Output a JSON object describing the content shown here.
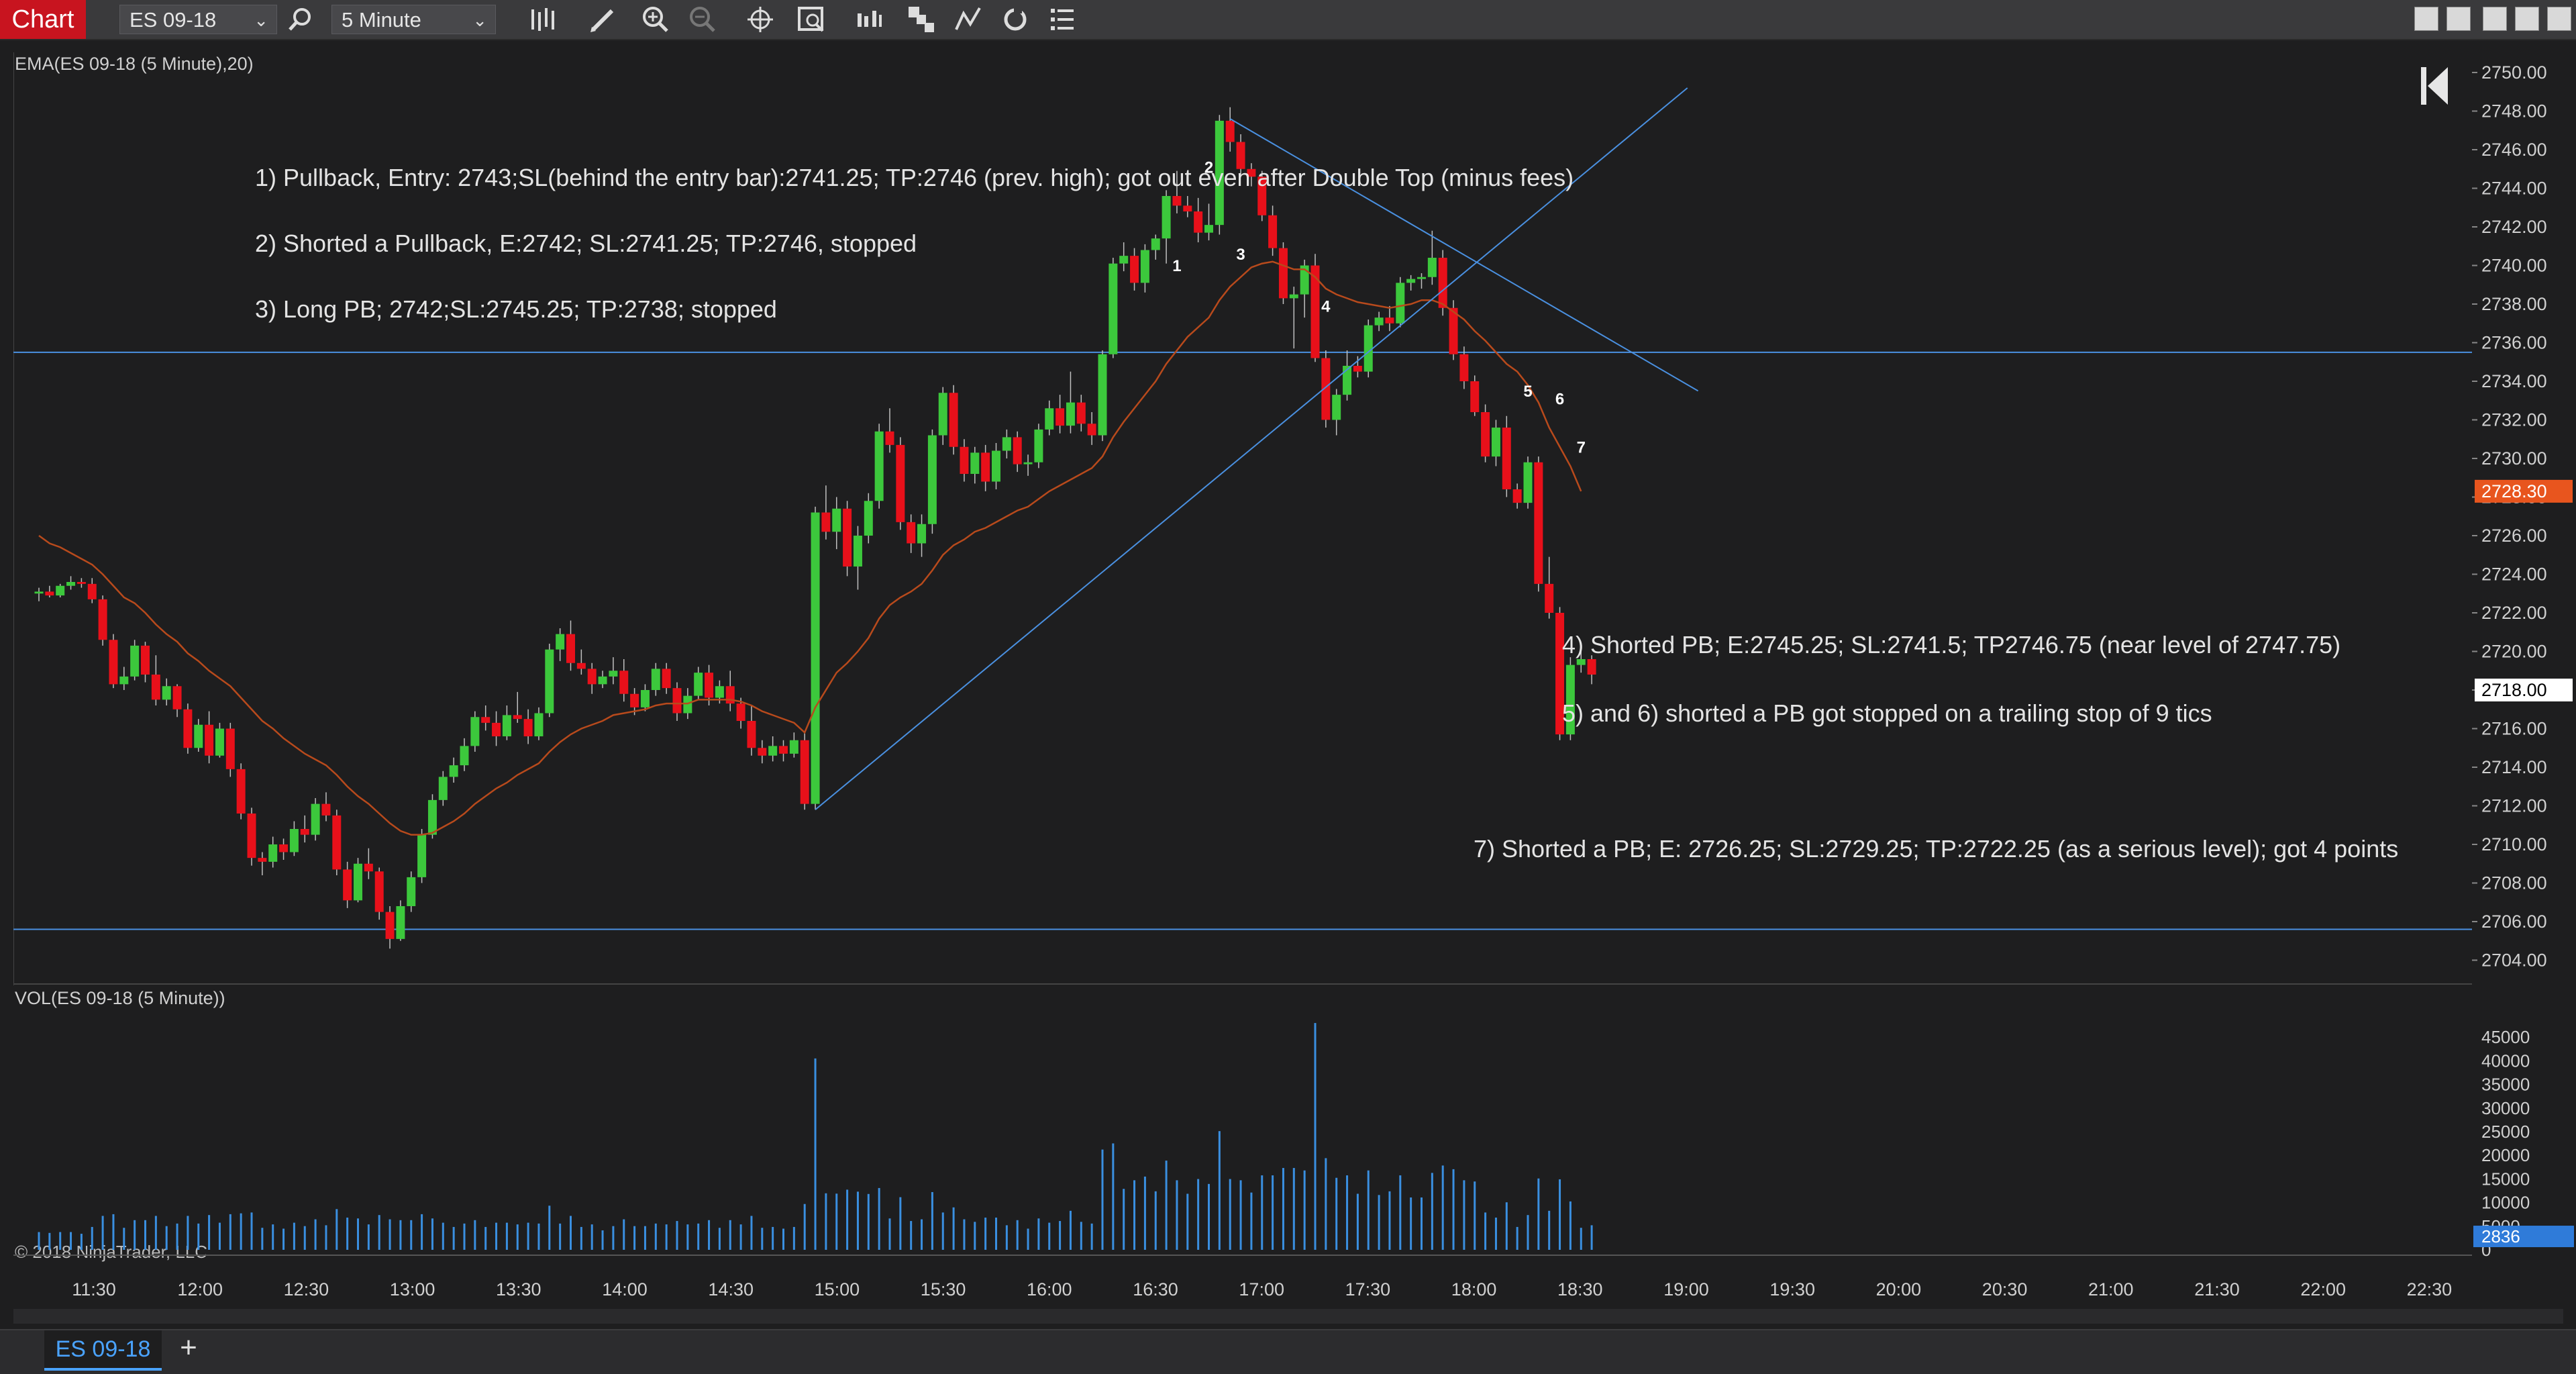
{
  "toolbar": {
    "chart_tab": "Chart",
    "instrument": "ES 09-18",
    "interval": "5 Minute",
    "icons": [
      "search-icon",
      "bars-type-icon",
      "pencil-icon",
      "zoom-in-icon",
      "zoom-out-icon",
      "crosshair-icon",
      "data-box-icon",
      "indicators-icon",
      "strategies-icon",
      "drawing-tools-icon",
      "reload-icon",
      "properties-icon"
    ],
    "window_buttons": [
      "tile-icon",
      "tile2-icon",
      "minimize-icon",
      "maximize-icon",
      "close-icon"
    ]
  },
  "panels": {
    "price_label": "EMA(ES 09-18 (5 Minute),20)",
    "volume_label": "VOL(ES 09-18 (5 Minute))"
  },
  "annotations": [
    "1)  Pullback, Entry: 2743;SL(behind the entry bar):2741.25; TP:2746 (prev. high); got out even after Double Top (minus fees)",
    "2) Shorted a Pullback, E:2742; SL:2741.25; TP:2746, stopped",
    "3) Long PB; 2742;SL:2745.25; TP:2738; stopped",
    "4) Shorted PB; E:2745.25; SL:2741.5; TP2746.75 (near level of 2747.75)",
    "5) and 6) shorted a PB got stopped on a trailing stop of 9 tics",
    "7) Shorted a PB; E: 2726.25; SL:2729.25; TP:2722.25 (as a serious level); got 4 points"
  ],
  "copyright": "© 2018 NinjaTrader, LLC",
  "bottom_tab": "ES 09-18",
  "add_tab": "+",
  "chart_data": {
    "type": "candlestick",
    "price_ylim": [
      2703,
      2751
    ],
    "price_ticks": [
      "2750.00",
      "2748.00",
      "2746.00",
      "2744.00",
      "2742.00",
      "2740.00",
      "2738.00",
      "2736.00",
      "2734.00",
      "2732.00",
      "2730.00",
      "2728.00",
      "2726.00",
      "2724.00",
      "2722.00",
      "2720.00",
      "2718.00",
      "2716.00",
      "2714.00",
      "2712.00",
      "2710.00",
      "2708.00",
      "2706.00",
      "2704.00"
    ],
    "current_price": "2718.00",
    "ema_label_value": "2728.30",
    "volume_ticks": [
      "45000",
      "40000",
      "35000",
      "30000",
      "25000",
      "20000",
      "15000",
      "10000",
      "5000",
      "0"
    ],
    "volume_ylim": [
      0,
      50000
    ],
    "current_volume": "2836",
    "x_ticks": [
      "11:30",
      "12:00",
      "12:30",
      "13:00",
      "13:30",
      "14:00",
      "14:30",
      "15:00",
      "15:30",
      "16:00",
      "16:30",
      "17:00",
      "17:30",
      "18:00",
      "18:30",
      "19:00",
      "19:30",
      "20:00",
      "20:30",
      "21:00",
      "21:30",
      "22:00",
      "22:30"
    ],
    "horizontal_levels": [
      2735.5,
      2705.6
    ],
    "colors": {
      "up": "#3cc83c",
      "down": "#e8101a",
      "ema": "#b84a1c",
      "volume": "#3a8fe0",
      "lines": "#4a90e0",
      "background": "#1e1e1f",
      "ema_label": "#e8551e"
    },
    "candles": [
      [
        2723,
        2723.3,
        2722.6,
        2723.1
      ],
      [
        2723.1,
        2723.4,
        2722.8,
        2722.9
      ],
      [
        2722.9,
        2723.5,
        2722.8,
        2723.4
      ],
      [
        2723.4,
        2723.9,
        2723.2,
        2723.6
      ],
      [
        2723.6,
        2723.8,
        2723.3,
        2723.5
      ],
      [
        2723.5,
        2723.8,
        2722.5,
        2722.7
      ],
      [
        2722.7,
        2722.9,
        2720.3,
        2720.6
      ],
      [
        2720.6,
        2720.9,
        2718.1,
        2718.3
      ],
      [
        2718.3,
        2719.2,
        2718,
        2718.7
      ],
      [
        2718.7,
        2720.6,
        2718.5,
        2720.3
      ],
      [
        2720.3,
        2720.5,
        2718.4,
        2718.8
      ],
      [
        2718.8,
        2719.8,
        2717.2,
        2717.5
      ],
      [
        2717.5,
        2718.6,
        2717.2,
        2718.2
      ],
      [
        2718.2,
        2718.3,
        2716.6,
        2717
      ],
      [
        2717,
        2717.3,
        2714.7,
        2715
      ],
      [
        2715,
        2716.5,
        2714.8,
        2716.2
      ],
      [
        2716.2,
        2716.9,
        2714.2,
        2714.6
      ],
      [
        2714.6,
        2716.3,
        2714.5,
        2716
      ],
      [
        2716,
        2716.3,
        2713.5,
        2713.9
      ],
      [
        2713.9,
        2714.2,
        2711.3,
        2711.6
      ],
      [
        2711.6,
        2711.9,
        2708.9,
        2709.3
      ],
      [
        2709.3,
        2709.6,
        2708.4,
        2709.1
      ],
      [
        2709.1,
        2710.4,
        2708.8,
        2710
      ],
      [
        2710,
        2710.3,
        2709.2,
        2709.6
      ],
      [
        2709.6,
        2711.2,
        2709.4,
        2710.8
      ],
      [
        2710.8,
        2711.5,
        2710.1,
        2710.5
      ],
      [
        2710.5,
        2712.4,
        2710.2,
        2712.1
      ],
      [
        2712.1,
        2712.7,
        2711.2,
        2711.5
      ],
      [
        2711.5,
        2711.8,
        2708.4,
        2708.7
      ],
      [
        2708.7,
        2709.1,
        2706.7,
        2707.1
      ],
      [
        2707.1,
        2709.3,
        2707,
        2709
      ],
      [
        2709,
        2709.8,
        2708.2,
        2708.6
      ],
      [
        2708.6,
        2708.8,
        2706.1,
        2706.5
      ],
      [
        2706.5,
        2706.8,
        2704.6,
        2705.1
      ],
      [
        2705.1,
        2707.1,
        2705,
        2706.8
      ],
      [
        2706.8,
        2708.6,
        2706.5,
        2708.3
      ],
      [
        2708.3,
        2710.8,
        2708,
        2710.5
      ],
      [
        2710.5,
        2712.6,
        2710.3,
        2712.3
      ],
      [
        2712.3,
        2713.8,
        2712,
        2713.5
      ],
      [
        2713.5,
        2714.5,
        2713.2,
        2714.1
      ],
      [
        2714.1,
        2715.5,
        2713.8,
        2715.1
      ],
      [
        2715.1,
        2716.9,
        2714.8,
        2716.6
      ],
      [
        2716.6,
        2717.2,
        2715.9,
        2716.3
      ],
      [
        2716.3,
        2716.9,
        2715.1,
        2715.6
      ],
      [
        2715.6,
        2717.2,
        2715.4,
        2716.7
      ],
      [
        2716.7,
        2717.9,
        2716.3,
        2716.5
      ],
      [
        2716.5,
        2717,
        2715.2,
        2715.6
      ],
      [
        2715.6,
        2717.1,
        2715.4,
        2716.8
      ],
      [
        2716.8,
        2720.4,
        2716.6,
        2720.1
      ],
      [
        2720.1,
        2721.2,
        2719.5,
        2720.9
      ],
      [
        2720.9,
        2721.6,
        2719,
        2719.4
      ],
      [
        2719.4,
        2720.1,
        2718.8,
        2719.1
      ],
      [
        2719.1,
        2719.4,
        2717.8,
        2718.3
      ],
      [
        2718.3,
        2719,
        2718.1,
        2718.7
      ],
      [
        2718.7,
        2719.7,
        2718.3,
        2719
      ],
      [
        2719,
        2719.6,
        2717.4,
        2717.8
      ],
      [
        2717.8,
        2718.1,
        2716.7,
        2717.1
      ],
      [
        2717.1,
        2718.3,
        2716.9,
        2718
      ],
      [
        2718,
        2719.4,
        2717.7,
        2719.1
      ],
      [
        2719.1,
        2719.4,
        2717.8,
        2718.1
      ],
      [
        2718.1,
        2718.4,
        2716.4,
        2716.8
      ],
      [
        2716.8,
        2718.1,
        2716.5,
        2717.7
      ],
      [
        2717.7,
        2719.2,
        2717.5,
        2718.9
      ],
      [
        2718.9,
        2719.3,
        2717.2,
        2717.6
      ],
      [
        2717.6,
        2718.5,
        2717.3,
        2718.2
      ],
      [
        2718.2,
        2719,
        2716.9,
        2717.3
      ],
      [
        2717.3,
        2717.6,
        2716,
        2716.4
      ],
      [
        2716.4,
        2717.2,
        2714.6,
        2715
      ],
      [
        2715,
        2715.4,
        2714.2,
        2714.6
      ],
      [
        2714.6,
        2715.6,
        2714.3,
        2715.1
      ],
      [
        2715.1,
        2715.4,
        2714.3,
        2714.7
      ],
      [
        2714.7,
        2715.8,
        2714.5,
        2715.4
      ],
      [
        2715.4,
        2715.8,
        2711.8,
        2712.1
      ],
      [
        2712.1,
        2727.5,
        2711.8,
        2727.2
      ],
      [
        2727.2,
        2728.6,
        2725.8,
        2726.2
      ],
      [
        2726.2,
        2728,
        2725.3,
        2727.4
      ],
      [
        2727.4,
        2727.8,
        2723.9,
        2724.4
      ],
      [
        2724.4,
        2726.5,
        2723.2,
        2726
      ],
      [
        2726,
        2728.2,
        2725.6,
        2727.8
      ],
      [
        2727.8,
        2731.8,
        2727.4,
        2731.4
      ],
      [
        2731.4,
        2732.6,
        2730.3,
        2730.7
      ],
      [
        2730.7,
        2731.1,
        2726.3,
        2726.7
      ],
      [
        2726.7,
        2727.1,
        2725.1,
        2725.6
      ],
      [
        2725.6,
        2727.1,
        2724.9,
        2726.6
      ],
      [
        2726.6,
        2731.5,
        2726.1,
        2731.2
      ],
      [
        2731.2,
        2733.7,
        2730.7,
        2733.4
      ],
      [
        2733.4,
        2733.8,
        2730.2,
        2730.6
      ],
      [
        2730.6,
        2731,
        2728.8,
        2729.2
      ],
      [
        2729.2,
        2730.6,
        2728.7,
        2730.3
      ],
      [
        2730.3,
        2730.7,
        2728.3,
        2728.8
      ],
      [
        2728.8,
        2730.8,
        2728.4,
        2730.4
      ],
      [
        2730.4,
        2731.5,
        2730,
        2731.1
      ],
      [
        2731.1,
        2731.4,
        2729.3,
        2729.7
      ],
      [
        2729.7,
        2730.2,
        2729.1,
        2729.8
      ],
      [
        2729.8,
        2731.8,
        2729.5,
        2731.5
      ],
      [
        2731.5,
        2733,
        2731.2,
        2732.6
      ],
      [
        2732.6,
        2733.3,
        2731.3,
        2731.7
      ],
      [
        2731.7,
        2734.5,
        2731.3,
        2732.9
      ],
      [
        2732.9,
        2733.3,
        2731.4,
        2731.8
      ],
      [
        2731.8,
        2732.4,
        2730.7,
        2731.2
      ],
      [
        2731.2,
        2735.6,
        2730.9,
        2735.4
      ],
      [
        2735.4,
        2740.4,
        2735.2,
        2740.1
      ],
      [
        2740.1,
        2741.2,
        2739.7,
        2740.5
      ],
      [
        2740.5,
        2740.9,
        2738.7,
        2739.1
      ],
      [
        2739.1,
        2741.1,
        2738.6,
        2740.8
      ],
      [
        2740.8,
        2741.6,
        2740.3,
        2741.4
      ],
      [
        2741.4,
        2743.9,
        2740.1,
        2743.6
      ],
      [
        2743.6,
        2744.9,
        2742.7,
        2743.1
      ],
      [
        2743.1,
        2743.6,
        2742.5,
        2742.8
      ],
      [
        2742.8,
        2743.5,
        2741.2,
        2741.7
      ],
      [
        2741.7,
        2743.2,
        2741.3,
        2742.1
      ],
      [
        2742.1,
        2747.8,
        2741.6,
        2747.5
      ],
      [
        2747.5,
        2748.2,
        2745.9,
        2746.4
      ],
      [
        2746.4,
        2746.8,
        2744.6,
        2745
      ],
      [
        2745,
        2745.3,
        2744.1,
        2744.6
      ],
      [
        2744.6,
        2744.9,
        2742.3,
        2742.6
      ],
      [
        2742.6,
        2743.1,
        2740.5,
        2740.9
      ],
      [
        2740.9,
        2741.2,
        2738,
        2738.3
      ],
      [
        2738.3,
        2738.9,
        2735.7,
        2738.5
      ],
      [
        2738.5,
        2740.3,
        2737.3,
        2740
      ],
      [
        2740,
        2740.6,
        2735,
        2735.2
      ],
      [
        2735.2,
        2735.6,
        2731.6,
        2732
      ],
      [
        2732,
        2733.6,
        2731.2,
        2733.3
      ],
      [
        2733.3,
        2735.6,
        2733,
        2734.8
      ],
      [
        2734.8,
        2735.3,
        2734.2,
        2734.5
      ],
      [
        2734.5,
        2737.2,
        2734.2,
        2736.9
      ],
      [
        2736.9,
        2737.6,
        2736.6,
        2737.3
      ],
      [
        2737.3,
        2737.9,
        2736.6,
        2737
      ],
      [
        2737,
        2739.4,
        2736.8,
        2739.1
      ],
      [
        2739.1,
        2739.5,
        2738.7,
        2739.3
      ],
      [
        2739.3,
        2739.6,
        2738.8,
        2739.4
      ],
      [
        2739.4,
        2741.8,
        2739,
        2740.4
      ],
      [
        2740.4,
        2740.8,
        2737.4,
        2737.8
      ],
      [
        2737.8,
        2738.2,
        2735.1,
        2735.4
      ],
      [
        2735.4,
        2735.8,
        2733.6,
        2734
      ],
      [
        2734,
        2734.3,
        2732.2,
        2732.4
      ],
      [
        2732.4,
        2732.8,
        2729.8,
        2730.1
      ],
      [
        2730.1,
        2732,
        2729.6,
        2731.6
      ],
      [
        2731.6,
        2732.2,
        2728,
        2728.4
      ],
      [
        2728.4,
        2728.7,
        2727.4,
        2727.7
      ],
      [
        2727.7,
        2730.1,
        2727.4,
        2729.8
      ],
      [
        2729.8,
        2730.1,
        2723.1,
        2723.5
      ],
      [
        2723.5,
        2724.9,
        2721.7,
        2722
      ],
      [
        2722,
        2722.3,
        2715.4,
        2715.7
      ],
      [
        2715.7,
        2719.7,
        2715.4,
        2719.3
      ],
      [
        2719.3,
        2720.1,
        2718.9,
        2719.6
      ],
      [
        2719.6,
        2719.8,
        2718.3,
        2718.8
      ]
    ],
    "ema": [
      2726,
      2725.6,
      2725.4,
      2725.1,
      2724.8,
      2724.5,
      2724,
      2723.4,
      2722.8,
      2722.5,
      2722,
      2721.4,
      2720.9,
      2720.5,
      2719.9,
      2719.5,
      2719,
      2718.6,
      2718.2,
      2717.6,
      2717,
      2716.4,
      2716,
      2715.5,
      2715.1,
      2714.7,
      2714.4,
      2714.1,
      2713.6,
      2713,
      2712.5,
      2712.1,
      2711.6,
      2711.1,
      2710.7,
      2710.5,
      2710.5,
      2710.6,
      2710.9,
      2711.2,
      2711.6,
      2712.1,
      2712.5,
      2712.9,
      2713.2,
      2713.6,
      2713.9,
      2714.2,
      2714.8,
      2715.3,
      2715.7,
      2716,
      2716.2,
      2716.4,
      2716.7,
      2716.8,
      2716.9,
      2717,
      2717.2,
      2717.3,
      2717.3,
      2717.3,
      2717.5,
      2717.5,
      2717.5,
      2717.5,
      2717.4,
      2717.2,
      2716.9,
      2716.7,
      2716.5,
      2716.3,
      2715.8,
      2717.1,
      2718,
      2718.9,
      2719.4,
      2720,
      2720.7,
      2721.7,
      2722.4,
      2722.8,
      2723.1,
      2723.5,
      2724.2,
      2725,
      2725.5,
      2725.8,
      2726.2,
      2726.4,
      2726.7,
      2727,
      2727.3,
      2727.5,
      2727.9,
      2728.3,
      2728.6,
      2728.9,
      2729.2,
      2729.5,
      2730.1,
      2731.1,
      2731.9,
      2732.6,
      2733.3,
      2734,
      2734.9,
      2735.6,
      2736.3,
      2736.8,
      2737.3,
      2738.2,
      2738.9,
      2739.4,
      2739.9,
      2740.1,
      2740.2,
      2740,
      2739.8,
      2739.8,
      2739.4,
      2738.8,
      2738.5,
      2738.3,
      2738.1,
      2738,
      2737.9,
      2737.8,
      2737.9,
      2738,
      2738.2,
      2738.2,
      2738,
      2737.6,
      2737.2,
      2736.6,
      2736.1,
      2735.5,
      2734.9,
      2734.5,
      2733.8,
      2732.9,
      2731.6,
      2730.6,
      2729.6,
      2728.3
    ]
  }
}
